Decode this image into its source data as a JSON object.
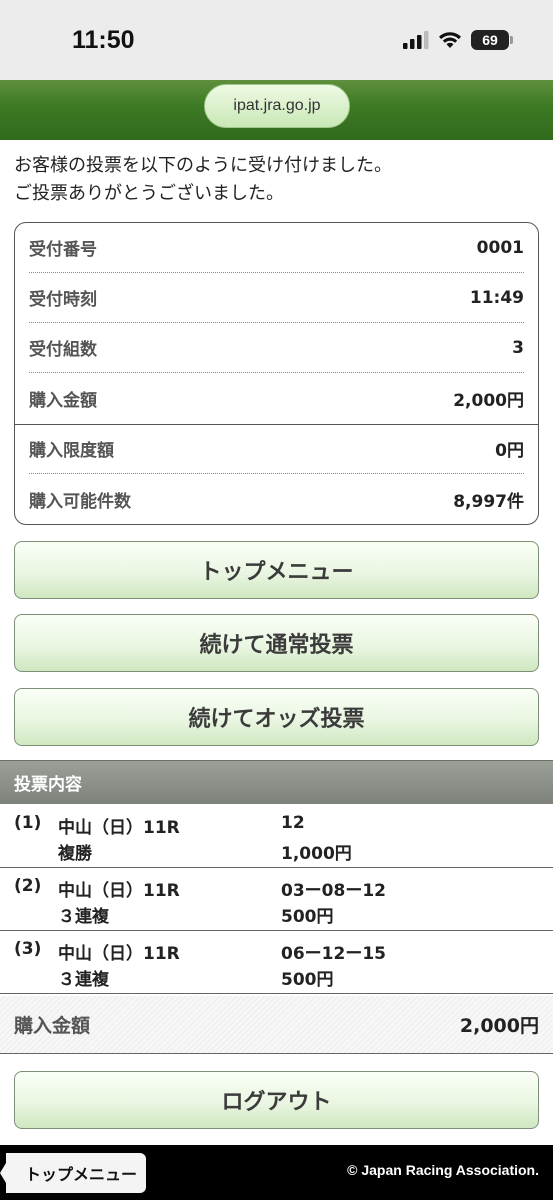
{
  "status_bar": {
    "time": "11:50",
    "battery": "69"
  },
  "browser": {
    "url": "ipat.jra.go.jp"
  },
  "message": {
    "line1": "お客様の投票を以下のように受け付けました。",
    "line2": "ご投票ありがとうございました。"
  },
  "receipt": [
    {
      "label": "受付番号",
      "value": "0001"
    },
    {
      "label": "受付時刻",
      "value": "11:49"
    },
    {
      "label": "受付組数",
      "value": "3"
    },
    {
      "label": "購入金額",
      "value": "2,000円"
    },
    {
      "label": "購入限度額",
      "value": "0円"
    },
    {
      "label": "購入可能件数",
      "value": "8,997件"
    }
  ],
  "buttons": {
    "top_menu": "トップメニュー",
    "continue_normal": "続けて通常投票",
    "continue_odds": "続けてオッズ投票",
    "logout": "ログアウト"
  },
  "bets": {
    "header": "投票内容",
    "items": [
      {
        "no": "(1)",
        "race": "中山（日）11R",
        "type": "複勝",
        "combo": "12",
        "amount": "1,000円"
      },
      {
        "no": "(2)",
        "race": "中山（日）11R",
        "type": "３連複",
        "combo": "03ー08ー12",
        "amount": "500円"
      },
      {
        "no": "(3)",
        "race": "中山（日）11R",
        "type": "３連複",
        "combo": "06ー12ー15",
        "amount": "500円"
      }
    ]
  },
  "total": {
    "label": "購入金額",
    "value": "2,000円"
  },
  "footer": {
    "back_label": "トップメニュー",
    "copyright": "© Japan Racing Association."
  },
  "colors": {
    "header_green": "#3d7a24",
    "button_green": "#cfe8c1",
    "section_gray": "#7d837a",
    "footer_black": "#000000"
  }
}
